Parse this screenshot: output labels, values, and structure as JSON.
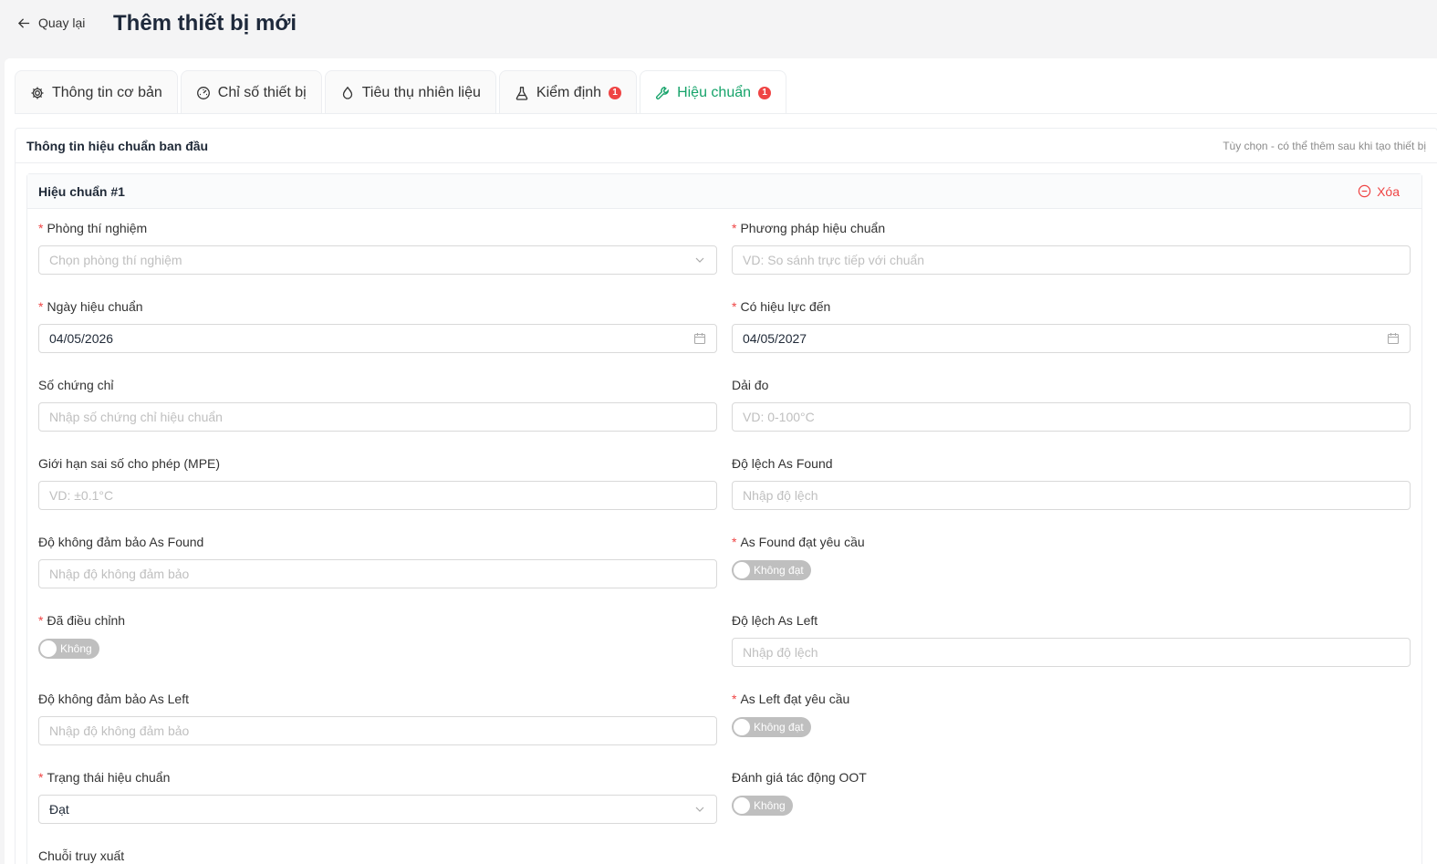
{
  "header": {
    "back_label": "Quay lại",
    "title": "Thêm thiết bị mới"
  },
  "tabs": [
    {
      "label": "Thông tin cơ bản",
      "icon": "gear-icon"
    },
    {
      "label": "Chỉ số thiết bị",
      "icon": "gauge-icon"
    },
    {
      "label": "Tiêu thụ nhiên liệu",
      "icon": "fuel-drop-icon"
    },
    {
      "label": "Kiểm định",
      "icon": "flask-icon",
      "badge": "1"
    },
    {
      "label": "Hiệu chuẩn",
      "icon": "wrench-icon",
      "badge": "1",
      "active": true
    }
  ],
  "section": {
    "title": "Thông tin hiệu chuẩn ban đầu",
    "note": "Tùy chọn - có thể thêm sau khi tạo thiết bị"
  },
  "calibration": {
    "title": "Hiệu chuẩn #1",
    "delete_label": "Xóa",
    "fields": {
      "lab": {
        "label": "Phòng thí nghiệm",
        "placeholder": "Chọn phòng thí nghiệm"
      },
      "method": {
        "label": "Phương pháp hiệu chuẩn",
        "placeholder": "VD: So sánh trực tiếp với chuẩn"
      },
      "calib_date": {
        "label": "Ngày hiệu chuẩn",
        "value": "04/05/2026"
      },
      "valid_until": {
        "label": "Có hiệu lực đến",
        "value": "04/05/2027"
      },
      "cert_no": {
        "label": "Số chứng chỉ",
        "placeholder": "Nhập số chứng chỉ hiệu chuẩn"
      },
      "range": {
        "label": "Dải đo",
        "placeholder": "VD: 0-100°C"
      },
      "mpe": {
        "label": "Giới hạn sai số cho phép (MPE)",
        "placeholder": "VD: ±0.1°C"
      },
      "dev_found": {
        "label": "Độ lệch As Found",
        "placeholder": "Nhập độ lệch"
      },
      "unc_found": {
        "label": "Độ không đảm bảo As Found",
        "placeholder": "Nhập độ không đảm bảo"
      },
      "found_ok": {
        "label": "As Found đạt yêu cầu",
        "switch": "Không đạt"
      },
      "adjusted": {
        "label": "Đã điều chỉnh",
        "switch": "Không"
      },
      "dev_left": {
        "label": "Độ lệch As Left",
        "placeholder": "Nhập độ lệch"
      },
      "unc_left": {
        "label": "Độ không đảm bảo As Left",
        "placeholder": "Nhập độ không đảm bảo"
      },
      "left_ok": {
        "label": "As Left đạt yêu cầu",
        "switch": "Không đạt"
      },
      "status": {
        "label": "Trạng thái hiệu chuẩn",
        "value": "Đạt"
      },
      "oot": {
        "label": "Đánh giá tác động OOT",
        "switch": "Không"
      },
      "trace": {
        "label": "Chuỗi truy xuất"
      }
    }
  }
}
